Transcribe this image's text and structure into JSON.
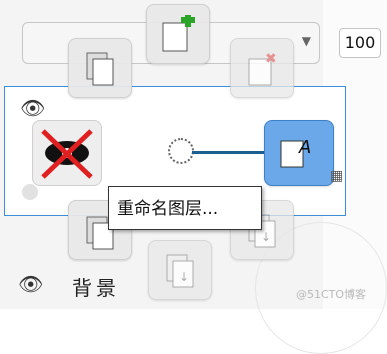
{
  "opacity": {
    "value": "100"
  },
  "layers": {
    "background_label": "背景"
  },
  "tooltip": {
    "text": "重命名图层..."
  },
  "tiles": {
    "copy": {
      "icon": "copy-layers-icon"
    },
    "new": {
      "icon": "new-layer-icon"
    },
    "delete": {
      "icon": "delete-layer-icon"
    },
    "rename": {
      "icon": "rename-layer-icon"
    },
    "hide": {
      "icon": "hide-layer-icon"
    },
    "duplicate": {
      "icon": "duplicate-icon"
    },
    "merge_down": {
      "icon": "merge-down-icon"
    },
    "move_down": {
      "icon": "move-down-icon"
    }
  },
  "watermark": "@51CTO博客",
  "colors": {
    "accent": "#3a8fd8",
    "active_tile": "#6aa8ea"
  }
}
